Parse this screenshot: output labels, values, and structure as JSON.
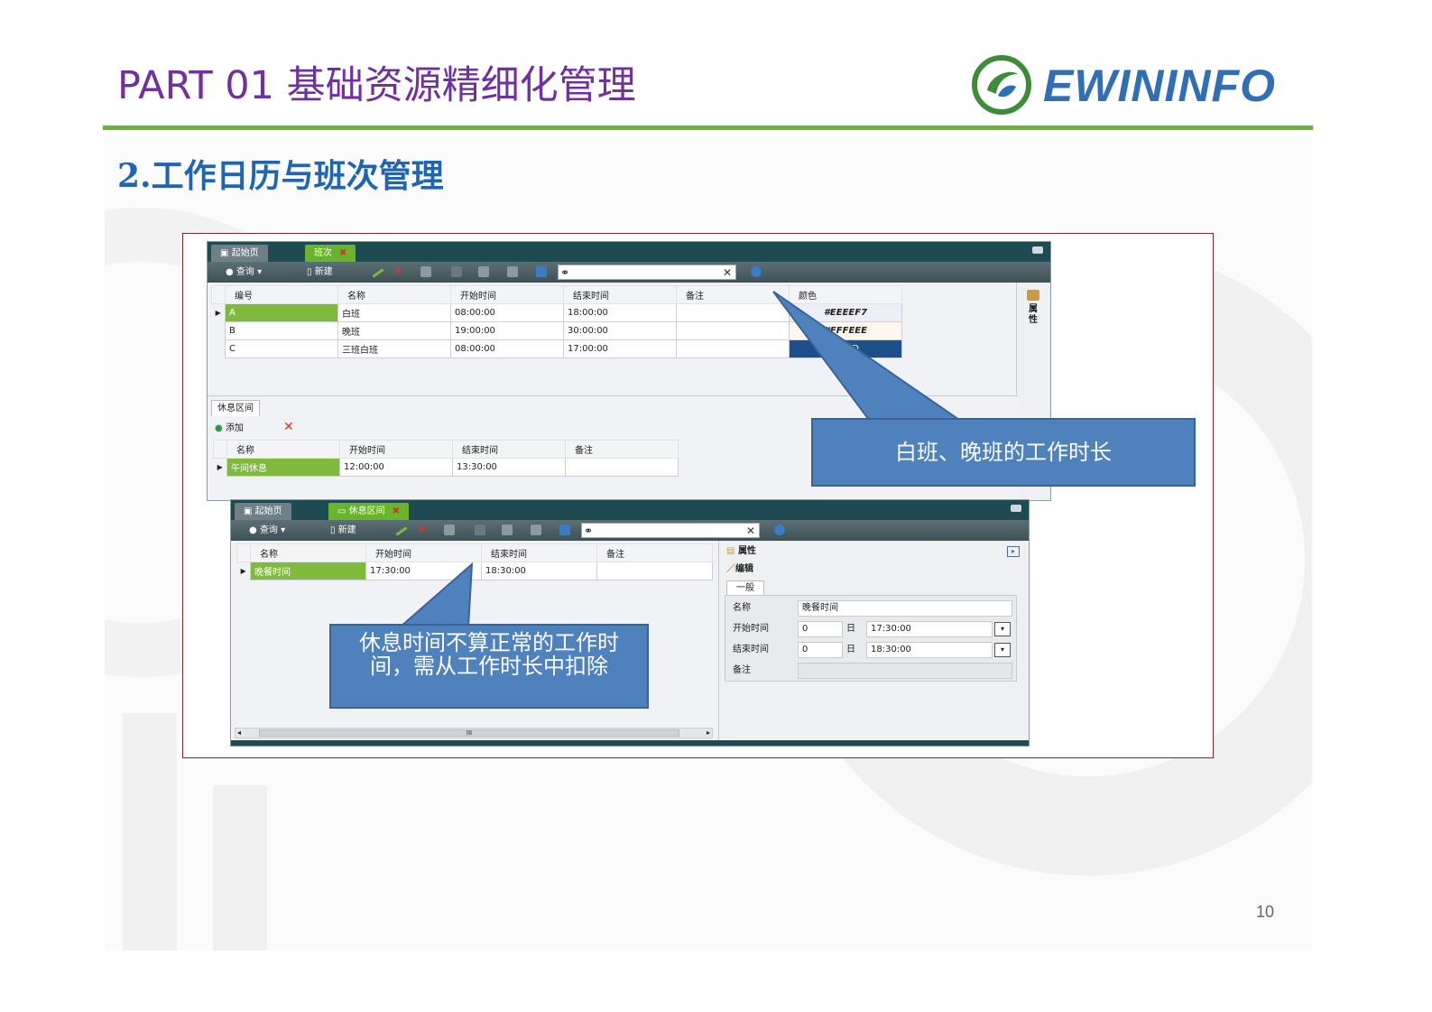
{
  "header": {
    "part_title": "PART 01  基础资源精细化管理",
    "logo_text": "EWININFO",
    "section_title": "2.工作日历与班次管理"
  },
  "colors": {
    "purple_title": "#7030a0",
    "blue_title": "#1f66b2",
    "green_rule": "#6ab42d",
    "callout_blue": "#4f81bd",
    "frame_border": "#7a2a2a"
  },
  "window1": {
    "tabs": [
      "起始页",
      "班次"
    ],
    "toolbar": {
      "query": "查询",
      "new": "新建"
    },
    "grid": {
      "columns": [
        "编号",
        "名称",
        "开始时间",
        "结束时间",
        "备注",
        "颜色"
      ],
      "rows": [
        {
          "code": "A",
          "name": "白班",
          "start": "08:00:00",
          "end": "18:00:00",
          "note": "",
          "color": "#EEEEF7"
        },
        {
          "code": "B",
          "name": "晚班",
          "start": "19:00:00",
          "end": "30:00:00",
          "note": "",
          "color": "#FFFEEE"
        },
        {
          "code": "C",
          "name": "三班白班",
          "start": "08:00:00",
          "end": "17:00:00",
          "note": "",
          "color": "...97D"
        }
      ]
    },
    "side_label": "属性",
    "break_tab": "休息区间",
    "break_toolbar": {
      "add": "添加"
    },
    "break_grid": {
      "columns": [
        "名称",
        "开始时间",
        "结束时间",
        "备注"
      ],
      "rows": [
        {
          "name": "午间休息",
          "start": "12:00:00",
          "end": "13:30:00",
          "note": ""
        }
      ]
    }
  },
  "window2": {
    "tabs": [
      "起始页",
      "休息区间"
    ],
    "toolbar": {
      "query": "查询",
      "new": "新建"
    },
    "grid": {
      "columns": [
        "名称",
        "开始时间",
        "结束时间",
        "备注"
      ],
      "rows": [
        {
          "name": "晚餐时间",
          "start": "17:30:00",
          "end": "18:30:00",
          "note": ""
        }
      ]
    },
    "props": {
      "title": "属性",
      "edit": "编辑",
      "tab": "一般",
      "name_label": "名称",
      "name_value": "晚餐时间",
      "start_label": "开始时间",
      "start_day": "0",
      "start_unit": "日",
      "start_value": "17:30:00",
      "end_label": "结束时间",
      "end_day": "0",
      "end_unit": "日",
      "end_value": "18:30:00",
      "note_label": "备注"
    },
    "scroll_label": "III"
  },
  "callouts": {
    "shift_duration": "白班、晚班的工作时长",
    "break_note": "休息时间不算正常的工作时间，需从工作时长中扣除"
  },
  "page_number": "10"
}
